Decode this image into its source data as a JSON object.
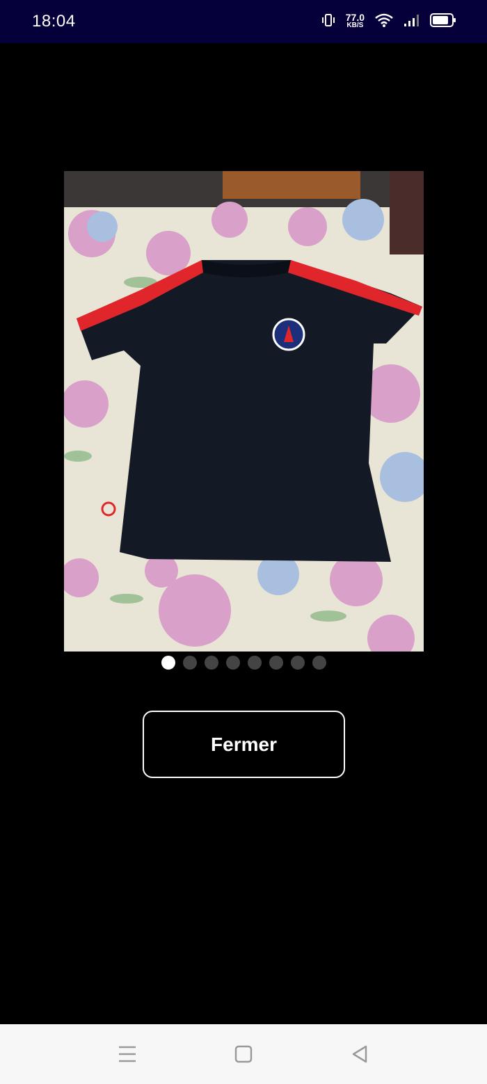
{
  "status_bar": {
    "time": "18:04",
    "net_speed_value": "77.0",
    "net_speed_unit": "KB/S",
    "icons": [
      "vibrate-icon",
      "wifi-icon",
      "signal-icon",
      "battery-icon"
    ]
  },
  "viewer": {
    "image_count": 8,
    "current_index": 0,
    "close_label": "Fermer"
  },
  "nav_bar": {
    "icons": [
      "menu-icon",
      "home-icon",
      "back-icon"
    ]
  },
  "colors": {
    "status_bar_bg": "#05003a",
    "viewer_bg": "#000000",
    "nav_bar_bg": "#f7f7f7",
    "dot_active": "#ffffff",
    "dot_inactive": "#444444"
  }
}
